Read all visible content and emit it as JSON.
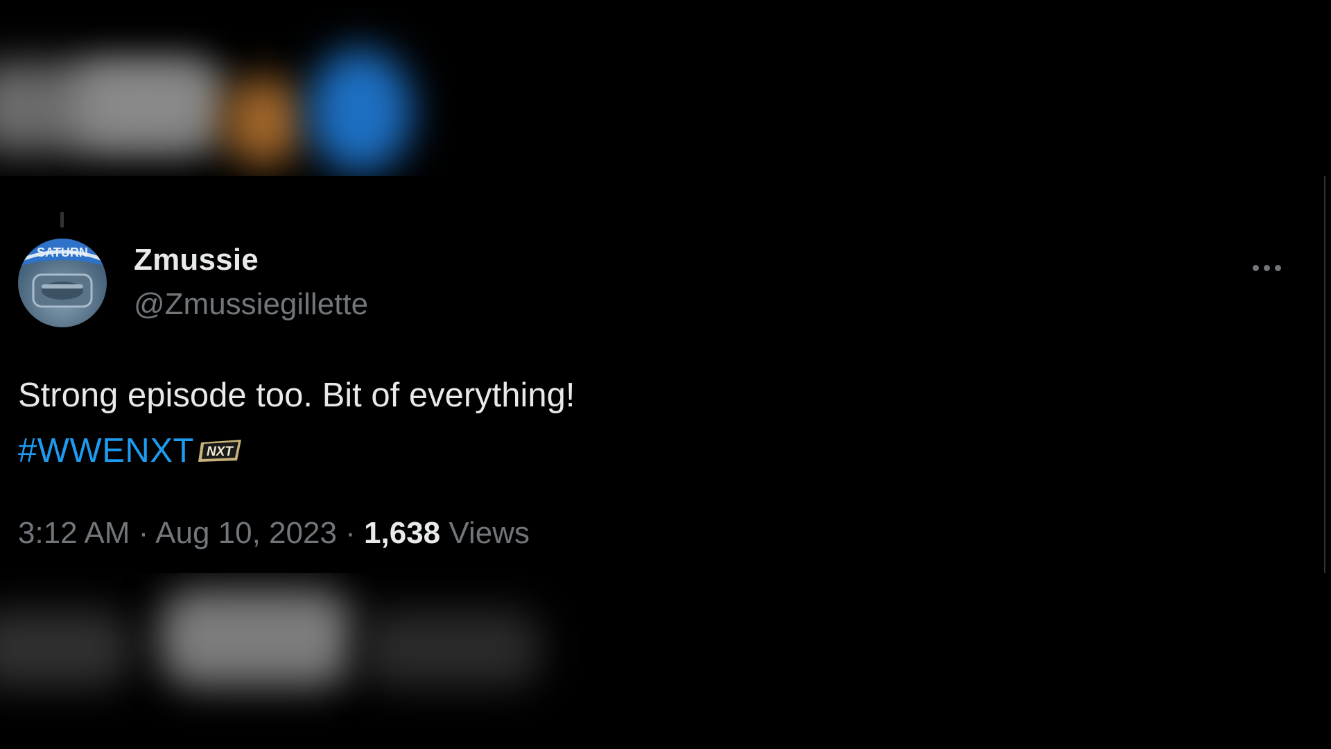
{
  "tweet": {
    "display_name": "Zmussie",
    "handle": "@Zmussiegillette",
    "text": "Strong episode too. Bit of everything!",
    "hashtag": "#WWENXT",
    "hashflag_text": "NXT",
    "time": "3:12 AM",
    "separator": "·",
    "date": "Aug 10, 2023",
    "views_count": "1,638",
    "views_label": "Views",
    "avatar_text": "SATURN",
    "more_icon": "more-horizontal-icon"
  },
  "colors": {
    "background": "#000000",
    "primary_text": "#e7e9ea",
    "secondary_text": "#71767b",
    "hashtag": "#1d9bf0",
    "border": "#2f3336"
  }
}
